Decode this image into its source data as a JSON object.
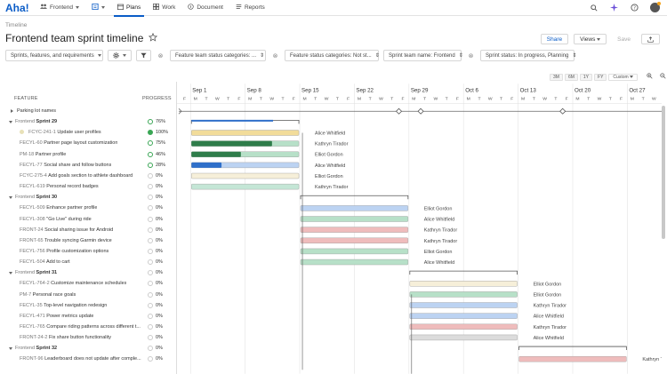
{
  "app": {
    "logo": "Aha!",
    "nav": [
      {
        "label": "Frontend",
        "icon": "people-icon",
        "caret": true
      },
      {
        "label": "",
        "icon": "workspace-icon",
        "caret": true
      },
      {
        "label": "Plans",
        "icon": "calendar-icon",
        "active": true
      },
      {
        "label": "Work",
        "icon": "grid-icon"
      },
      {
        "label": "Document",
        "icon": "document-icon"
      },
      {
        "label": "Reports",
        "icon": "list-icon"
      }
    ]
  },
  "breadcrumb": "Timeline",
  "page_title": "Frontend team sprint timeline",
  "header_buttons": {
    "share": "Share",
    "views": "Views",
    "save": "Save"
  },
  "filters": {
    "scope": "Sprints, features, and requirements",
    "f1": "Feature team status categories: ...",
    "f2": "Feature status categories: Not st...",
    "f3": "Sprint team name: Frontend",
    "f4": "Sprint status: In progress, Planning"
  },
  "zoom": [
    "3M",
    "6M",
    "1Y",
    "FY",
    "Custom"
  ],
  "columns": {
    "feature": "FEATURE",
    "progress": "PROGRESS"
  },
  "weeks": [
    "Sep 1",
    "Sep 8",
    "Sep 15",
    "Sep 22",
    "Sep 29",
    "Oct 6",
    "Oct 13",
    "Oct 20",
    "Oct 27"
  ],
  "days": [
    "F",
    "M",
    "T",
    "W",
    "T",
    "F",
    "M",
    "T",
    "W",
    "T",
    "F",
    "M",
    "T",
    "W",
    "T",
    "F",
    "M",
    "T",
    "W",
    "T",
    "F",
    "M",
    "T",
    "W",
    "T",
    "F",
    "M",
    "T",
    "W",
    "T",
    "F",
    "M",
    "T",
    "W",
    "T",
    "F",
    "M",
    "T",
    "W",
    "T",
    "F",
    "M",
    "T",
    "W"
  ],
  "rows": [
    {
      "type": "parking",
      "label": "Parking lot names"
    },
    {
      "type": "sprint",
      "prefix": "Frontend",
      "label": "Sprint 29",
      "progress": "76%"
    },
    {
      "type": "feature",
      "key": "FCYC-241-1",
      "label": "Update user profiles",
      "progress": "100%",
      "assignee": "Alice Whitfield",
      "color": "#f2dc9a",
      "fill": 1.0
    },
    {
      "type": "feature",
      "key": "FECYL-60",
      "label": "Partner page layout customization",
      "progress": "75%",
      "assignee": "Kathryn Tirador",
      "color": "#b7e0c8",
      "fill": 0.75
    },
    {
      "type": "feature",
      "key": "PM-18",
      "label": "Partner profile",
      "progress": "46%",
      "assignee": "Elliot Gordon",
      "color": "#b7e0c8",
      "fill": 0.46
    },
    {
      "type": "feature",
      "key": "FECYL-77",
      "label": "Social share and follow buttons",
      "progress": "28%",
      "assignee": "Alice Whitfield",
      "color": "#bcd3f2",
      "fill": 0.28
    },
    {
      "type": "feature",
      "key": "FCYC-275-4",
      "label": "Add goals section to athlete dashboard",
      "progress": "0%",
      "assignee": "Elliot Gordon",
      "color": "#f6efd9",
      "fill": 0
    },
    {
      "type": "feature",
      "key": "FECYL-619",
      "label": "Personal record badges",
      "progress": "0%",
      "assignee": "Kathryn Tirador",
      "color": "#c4e6d6",
      "fill": 0
    },
    {
      "type": "sprint",
      "prefix": "Frontend",
      "label": "Sprint 30",
      "progress": "0%"
    },
    {
      "type": "feature",
      "key": "FECYL-509",
      "label": "Enhance partner profile",
      "progress": "0%",
      "assignee": "Elliot Gordon",
      "color": "#bcd3f2",
      "fill": 0
    },
    {
      "type": "feature",
      "key": "FECYL-308",
      "label": "\"Go Live\" during ride",
      "progress": "0%",
      "assignee": "Alice Whitfield",
      "color": "#b7e0c8",
      "fill": 0
    },
    {
      "type": "feature",
      "key": "FRONT-24",
      "label": "Social sharing issue for Android",
      "progress": "0%",
      "assignee": "Kathryn Tirador",
      "color": "#efbcbc",
      "fill": 0
    },
    {
      "type": "feature",
      "key": "FRONT-65",
      "label": "Trouble syncing Garmin device",
      "progress": "0%",
      "assignee": "Kathryn Tirador",
      "color": "#efbcbc",
      "fill": 0
    },
    {
      "type": "feature",
      "key": "FECYL-756",
      "label": "Profile customization options",
      "progress": "0%",
      "assignee": "Elliot Gordon",
      "color": "#b7e0c8",
      "fill": 0
    },
    {
      "type": "feature",
      "key": "FECYL-504",
      "label": "Add to cart",
      "progress": "0%",
      "assignee": "Alice Whitfield",
      "color": "#b7e0c8",
      "fill": 0
    },
    {
      "type": "sprint",
      "prefix": "Frontend",
      "label": "Sprint 31",
      "progress": "0%"
    },
    {
      "type": "feature",
      "key": "FECYL-764-2",
      "label": "Customize maintenance schedules",
      "progress": "0%",
      "assignee": "Elliot Gordon",
      "color": "#f6efd9",
      "fill": 0
    },
    {
      "type": "feature",
      "key": "PM-7",
      "label": "Personal race goals",
      "progress": "0%",
      "assignee": "Elliot Gordon",
      "color": "#b7e0c8",
      "fill": 0
    },
    {
      "type": "feature",
      "key": "FECYL-35",
      "label": "Top-level navigation redesign",
      "progress": "0%",
      "assignee": "Kathryn Tirador",
      "color": "#bcd3f2",
      "fill": 0
    },
    {
      "type": "feature",
      "key": "FECYL-471",
      "label": "Power metrics update",
      "progress": "0%",
      "assignee": "Alice Whitfield",
      "color": "#bcd3f2",
      "fill": 0
    },
    {
      "type": "feature",
      "key": "FECYL-765",
      "label": "Compare riding patterns across different t...",
      "progress": "0%",
      "assignee": "Kathryn Tirador",
      "color": "#efbcbc",
      "fill": 0
    },
    {
      "type": "feature",
      "key": "FRONT-24-2",
      "label": "Fix share button functionality",
      "progress": "0%",
      "assignee": "Alice Whitfield",
      "color": "#dcdcdc",
      "fill": 0
    },
    {
      "type": "sprint",
      "prefix": "Frontend",
      "label": "Sprint 32",
      "progress": "0%"
    },
    {
      "type": "feature",
      "key": "FRONT-96",
      "label": "Leaderboard does not update after comple...",
      "progress": "0%",
      "assignee": "Kathryn Tirador",
      "color": "#efbcbc",
      "fill": 0
    }
  ],
  "colors": {
    "accent": "#0a5cc7",
    "progress_ring": "#3aa655",
    "fill_green": "#2e7d4a",
    "fill_blue": "#2f6fc9"
  }
}
